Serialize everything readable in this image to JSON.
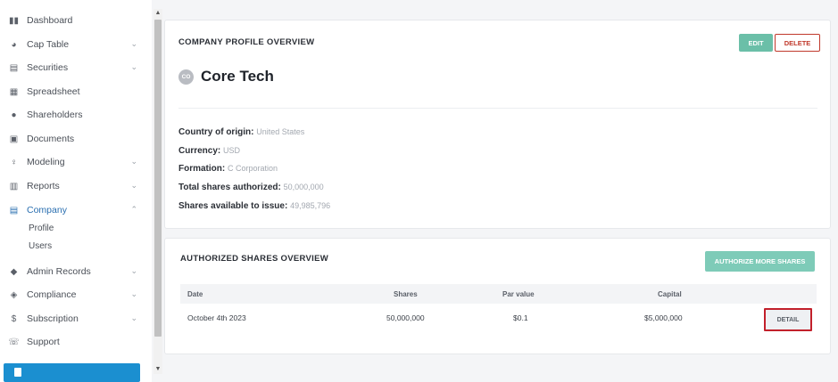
{
  "sidebar": {
    "items": [
      {
        "label": "Dashboard",
        "icon": "dashboard-icon",
        "has_chevron": false
      },
      {
        "label": "Cap Table",
        "icon": "pie-chart-icon",
        "has_chevron": true
      },
      {
        "label": "Securities",
        "icon": "clipboard-icon",
        "has_chevron": true
      },
      {
        "label": "Spreadsheet",
        "icon": "spreadsheet-icon",
        "has_chevron": false
      },
      {
        "label": "Shareholders",
        "icon": "user-icon",
        "has_chevron": false
      },
      {
        "label": "Documents",
        "icon": "folder-icon",
        "has_chevron": false
      },
      {
        "label": "Modeling",
        "icon": "lightbulb-icon",
        "has_chevron": true
      },
      {
        "label": "Reports",
        "icon": "report-icon",
        "has_chevron": true
      },
      {
        "label": "Company",
        "icon": "building-icon",
        "has_chevron": true,
        "active": true
      },
      {
        "label": "Admin Records",
        "icon": "admin-records-icon",
        "has_chevron": true
      },
      {
        "label": "Compliance",
        "icon": "shield-check-icon",
        "has_chevron": true
      },
      {
        "label": "Subscription",
        "icon": "dollar-icon",
        "has_chevron": true
      },
      {
        "label": "Support",
        "icon": "support-icon",
        "has_chevron": false
      }
    ],
    "company_subitems": [
      "Profile",
      "Users"
    ]
  },
  "profile_card": {
    "title": "COMPANY PROFILE OVERVIEW",
    "edit_label": "EDIT",
    "delete_label": "DELETE",
    "avatar_initials": "CO",
    "company_name": "Core Tech",
    "fields": [
      {
        "label": "Country of origin:",
        "value": "United States"
      },
      {
        "label": "Currency:",
        "value": "USD"
      },
      {
        "label": "Formation:",
        "value": "C Corporation"
      },
      {
        "label": "Total shares authorized:",
        "value": "50,000,000"
      },
      {
        "label": "Shares available to issue:",
        "value": "49,985,796"
      }
    ]
  },
  "shares_card": {
    "title": "AUTHORIZED SHARES OVERVIEW",
    "authorize_label": "AUTHORIZE MORE SHARES",
    "columns": [
      "Date",
      "Shares",
      "Par value",
      "Capital"
    ],
    "rows": [
      {
        "date": "October 4th 2023",
        "shares": "50,000,000",
        "par_value": "$0.1",
        "capital": "$5,000,000",
        "action": "DETAIL"
      }
    ]
  },
  "colors": {
    "accent_teal": "#6bbfa8",
    "delete_red": "#c0392b",
    "active_blue": "#2a6fb0",
    "highlight_red": "#c2202b"
  }
}
